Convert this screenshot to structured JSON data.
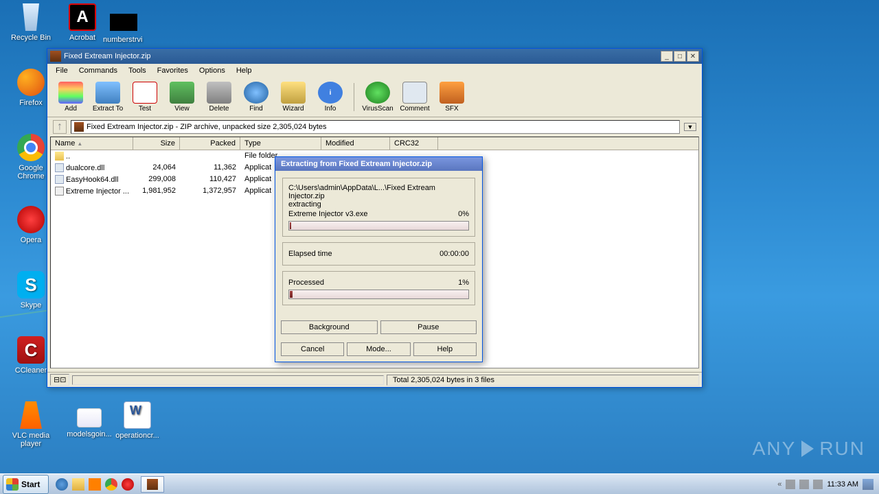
{
  "desktop": {
    "recycle": "Recycle Bin",
    "acrobat": "Acrobat",
    "numbers": "numberstrvi",
    "firefox": "Firefox",
    "chrome": "Google Chrome",
    "opera": "Opera",
    "skype": "Skype",
    "ccleaner": "CCleaner",
    "vlc": "VLC media player",
    "models": "modelsgoin...",
    "operation": "operationcr..."
  },
  "winrar": {
    "title": "Fixed Extream Injector.zip",
    "menu": [
      "File",
      "Commands",
      "Tools",
      "Favorites",
      "Options",
      "Help"
    ],
    "tools": [
      "Add",
      "Extract To",
      "Test",
      "View",
      "Delete",
      "Find",
      "Wizard",
      "Info",
      "VirusScan",
      "Comment",
      "SFX"
    ],
    "path": "Fixed Extream Injector.zip - ZIP archive, unpacked size 2,305,024 bytes",
    "cols": {
      "name": "Name",
      "size": "Size",
      "packed": "Packed",
      "type": "Type",
      "modified": "Modified",
      "crc": "CRC32"
    },
    "rows": [
      {
        "icon": "folder",
        "name": "..",
        "size": "",
        "packed": "",
        "type": "File folder"
      },
      {
        "icon": "dll",
        "name": "dualcore.dll",
        "size": "24,064",
        "packed": "11,362",
        "type": "Applicat"
      },
      {
        "icon": "dll",
        "name": "EasyHook64.dll",
        "size": "299,008",
        "packed": "110,427",
        "type": "Applicat"
      },
      {
        "icon": "exe",
        "name": "Extreme Injector ...",
        "size": "1,981,952",
        "packed": "1,372,957",
        "type": "Applicat"
      }
    ],
    "status_total": "Total 2,305,024 bytes in 3 files"
  },
  "dialog": {
    "title": "Extracting from Fixed Extream Injector.zip",
    "path": "C:\\Users\\admin\\AppData\\L...\\Fixed Extream Injector.zip",
    "action": "extracting",
    "file": "Extreme Injector v3.exe",
    "file_pct": "0%",
    "elapsed_label": "Elapsed time",
    "elapsed": "00:00:00",
    "processed_label": "Processed",
    "processed_pct": "1%",
    "btn_background": "Background",
    "btn_pause": "Pause",
    "btn_cancel": "Cancel",
    "btn_mode": "Mode...",
    "btn_help": "Help"
  },
  "taskbar": {
    "start": "Start",
    "time": "11:33 AM"
  },
  "watermark": "ANY    RUN"
}
